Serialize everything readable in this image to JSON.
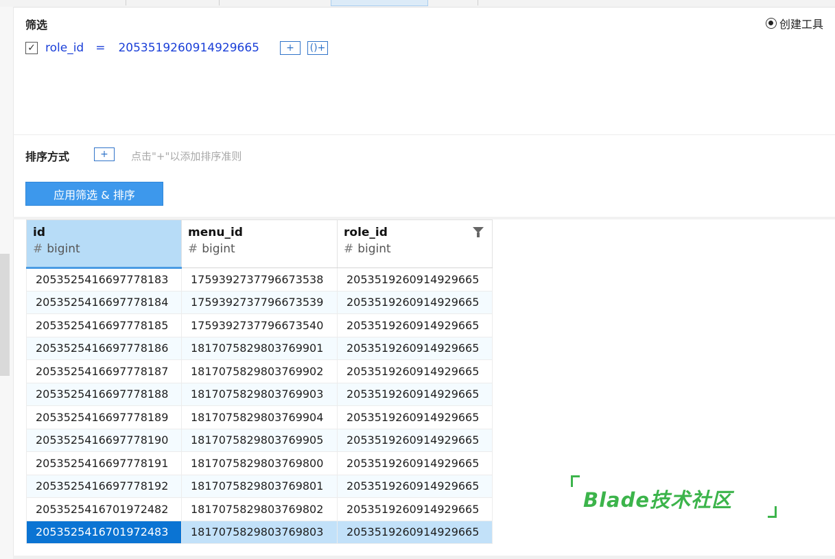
{
  "filter": {
    "title": "筛选",
    "create_tool_label": "创建工具",
    "condition": {
      "checked": true,
      "check_glyph": "✓",
      "field": "role_id",
      "operator": "=",
      "value": "2053519260914929665",
      "add_label": "+",
      "group_label": "()+"
    }
  },
  "sort": {
    "title": "排序方式",
    "add_label": "+",
    "hint": "点击\"+\"以添加排序准则"
  },
  "apply_button": "应用筛选 & 排序",
  "grid": {
    "columns": [
      {
        "name": "id",
        "type": "bigint",
        "type_icon": "#"
      },
      {
        "name": "menu_id",
        "type": "bigint",
        "type_icon": "#"
      },
      {
        "name": "role_id",
        "type": "bigint",
        "type_icon": "#",
        "filtered": true
      }
    ],
    "rows": [
      [
        "2053525416697778183",
        "1759392737796673538",
        "2053519260914929665"
      ],
      [
        "2053525416697778184",
        "1759392737796673539",
        "2053519260914929665"
      ],
      [
        "2053525416697778185",
        "1759392737796673540",
        "2053519260914929665"
      ],
      [
        "2053525416697778186",
        "1817075829803769901",
        "2053519260914929665"
      ],
      [
        "2053525416697778187",
        "1817075829803769902",
        "2053519260914929665"
      ],
      [
        "2053525416697778188",
        "1817075829803769903",
        "2053519260914929665"
      ],
      [
        "2053525416697778189",
        "1817075829803769904",
        "2053519260914929665"
      ],
      [
        "2053525416697778190",
        "1817075829803769905",
        "2053519260914929665"
      ],
      [
        "2053525416697778191",
        "1817075829803769800",
        "2053519260914929665"
      ],
      [
        "2053525416697778192",
        "1817075829803769801",
        "2053519260914929665"
      ],
      [
        "2053525416701972482",
        "1817075829803769802",
        "2053519260914929665"
      ],
      [
        "2053525416701972483",
        "1817075829803769803",
        "2053519260914929665"
      ]
    ],
    "selected_row_index": 11
  },
  "watermark": "Blade技术社区",
  "colors": {
    "accent": "#3d98ec",
    "link_blue": "#1a3fd8",
    "selected_cell": "#0b74d3",
    "watermark": "#3cb44b"
  }
}
